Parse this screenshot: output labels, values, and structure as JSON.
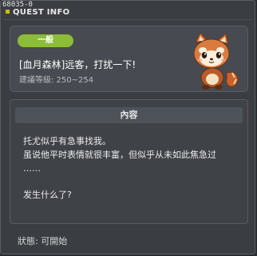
{
  "window": {
    "id_label": "68035-0",
    "title": "QUEST INFO"
  },
  "quest": {
    "category": "一般",
    "title": "[血月森林]远客，打扰一下!",
    "level_label": "建議等級: 250~254",
    "mascot_icon": "red-panda-icon"
  },
  "content": {
    "header": "內容",
    "lines": [
      "托尤似乎有急事找我。",
      "虽说他平时表情就很丰富，但似乎从未如此焦急过",
      "……",
      "",
      "发生什么了?"
    ]
  },
  "status": {
    "label": "狀態: 可開始"
  },
  "colors": {
    "badge": "#8bbd37",
    "window_bg": "#3a3d42",
    "card_bg": "#474b51"
  }
}
